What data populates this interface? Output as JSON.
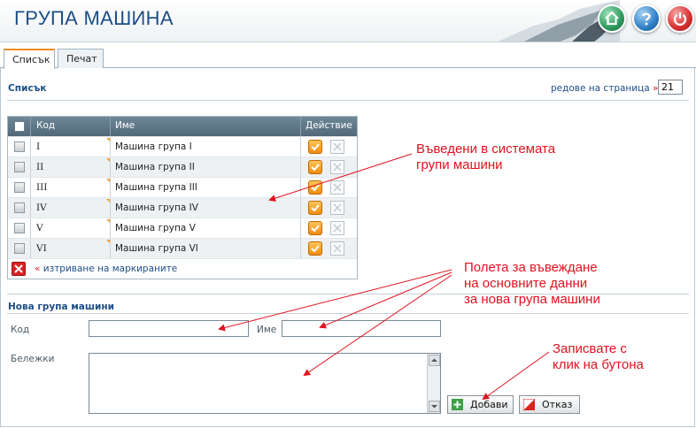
{
  "header": {
    "title": "ГРУПА МАШИНА"
  },
  "header_buttons": [
    {
      "name": "home",
      "icon": "home-icon"
    },
    {
      "name": "help",
      "icon": "question-icon"
    },
    {
      "name": "power",
      "icon": "power-icon"
    }
  ],
  "tabs": [
    {
      "label": "Списък",
      "active": true
    },
    {
      "label": "Печат",
      "active": false
    }
  ],
  "list": {
    "title": "Списък",
    "rows_per_page_label": "редове на страница",
    "rows_per_page_value": "21"
  },
  "table": {
    "columns": [
      "Код",
      "Име",
      "Действие"
    ],
    "rows": [
      {
        "code": "I",
        "name": "Машина група I"
      },
      {
        "code": "II",
        "name": "Машина група II"
      },
      {
        "code": "III",
        "name": "Машина група III"
      },
      {
        "code": "IV",
        "name": "Машина група IV"
      },
      {
        "code": "V",
        "name": "Машина група V"
      },
      {
        "code": "VI",
        "name": "Машина група VI"
      }
    ],
    "delete_marked_label": "изтриване на маркираните"
  },
  "form": {
    "title": "Нова група машини",
    "code_label": "Код",
    "code_value": "",
    "name_label": "Име",
    "name_value": "",
    "notes_label": "Бележки",
    "notes_value": "",
    "add_button": "Добави",
    "cancel_button": "Отказ"
  },
  "annotations": {
    "entered_groups": "Въведени в системата\nгрупи машини",
    "input_fields": "Полета за въвеждане\nна основните данни\nза нова група машини",
    "save_hint": "Записвате с\nклик на бутона"
  },
  "colors": {
    "title_blue": "#1e4e86",
    "annotation_red": "#e0121f",
    "tab_accent": "#f08c24",
    "grid_header": "#5d7686"
  }
}
